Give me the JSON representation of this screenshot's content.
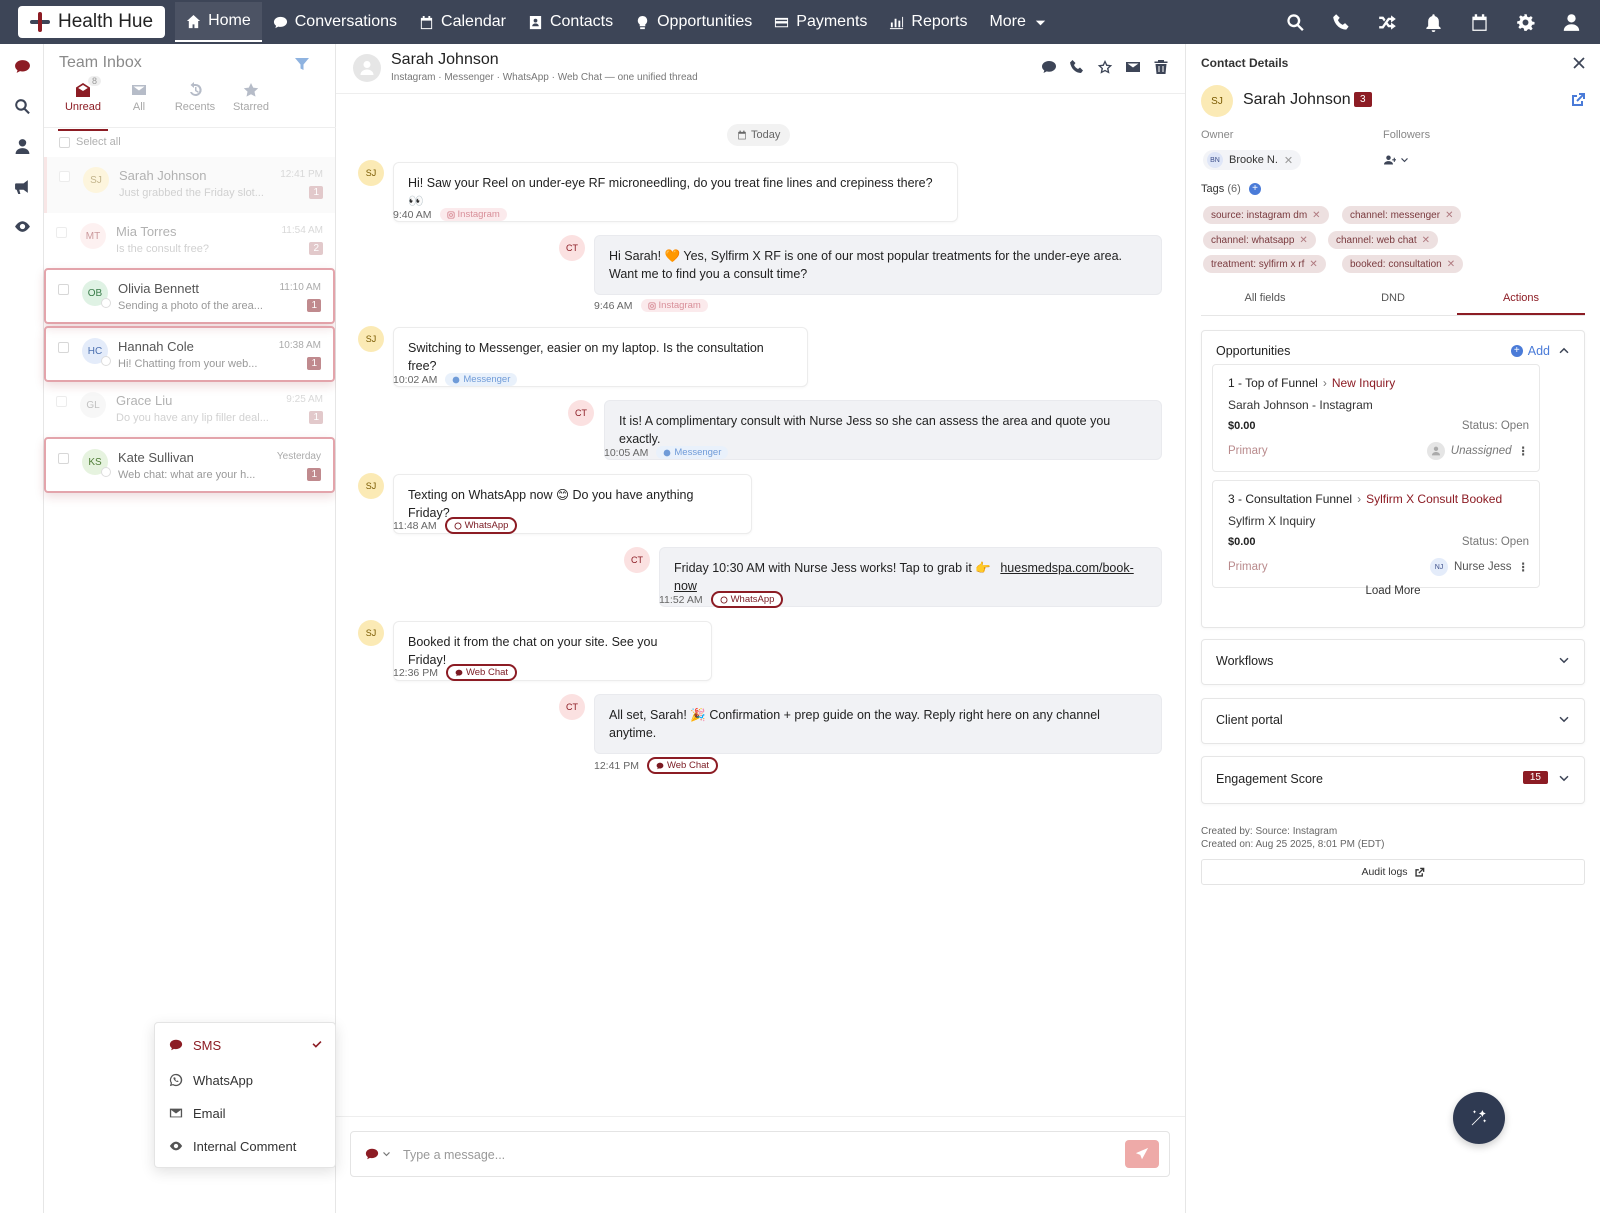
{
  "brand": {
    "name": "Health Hue"
  },
  "nav": {
    "items": [
      {
        "label": "Home",
        "icon": "home-icon"
      },
      {
        "label": "Conversations",
        "icon": "chat-icon"
      },
      {
        "label": "Calendar",
        "icon": "calendar-icon"
      },
      {
        "label": "Contacts",
        "icon": "contacts-icon"
      },
      {
        "label": "Opportunities",
        "icon": "lightbulb-icon"
      },
      {
        "label": "Payments",
        "icon": "card-icon"
      },
      {
        "label": "Reports",
        "icon": "chart-icon"
      },
      {
        "label": "More",
        "icon": "caret-down-icon"
      }
    ],
    "right_icons": [
      "search-icon",
      "phone-icon",
      "shuffle-icon",
      "bell-icon",
      "calendar-icon",
      "gear-icon",
      "user-icon"
    ]
  },
  "rail": {
    "icons": [
      "chat-icon",
      "search-icon",
      "user-icon",
      "megaphone-icon",
      "eye-icon"
    ]
  },
  "inbox": {
    "title": "Team Inbox",
    "tabs": [
      {
        "label": "Unread",
        "count": "8"
      },
      {
        "label": "All"
      },
      {
        "label": "Recents"
      },
      {
        "label": "Starred"
      }
    ],
    "select_all": "Select all",
    "conversations": [
      {
        "initials": "SJ",
        "name": "Sarah Johnson",
        "snippet": "Just grabbed the Friday slot...",
        "time": "12:41 PM",
        "badge": "1"
      },
      {
        "initials": "MT",
        "name": "Mia Torres",
        "snippet": "Is the consult free?",
        "time": "11:54 AM",
        "badge": "2"
      },
      {
        "initials": "OB",
        "name": "Olivia Bennett",
        "snippet": "Sending a photo of the area...",
        "time": "11:10 AM",
        "badge": "1"
      },
      {
        "initials": "HC",
        "name": "Hannah Cole",
        "snippet": "Hi! Chatting from your web...",
        "time": "10:38 AM",
        "badge": "1"
      },
      {
        "initials": "GL",
        "name": "Grace Liu",
        "snippet": "Do you have any lip filler deal...",
        "time": "9:25 AM",
        "badge": "1"
      },
      {
        "initials": "KS",
        "name": "Kate Sullivan",
        "snippet": "Web chat: what are your h...",
        "time": "Yesterday",
        "badge": "1"
      }
    ]
  },
  "channel_menu": {
    "items": [
      {
        "label": "SMS"
      },
      {
        "label": "WhatsApp"
      },
      {
        "label": "Email"
      },
      {
        "label": "Internal Comment"
      }
    ]
  },
  "chat": {
    "name": "Sarah Johnson",
    "subtitle": "Instagram · Messenger · WhatsApp · Web Chat — one unified thread",
    "today": "Today",
    "messages": [
      {
        "from": "SJ",
        "text": "Hi! Saw your Reel on under-eye RF microneedling, do you treat fine lines and crepiness there? 👀",
        "time": "9:40 AM",
        "channel": "Instagram"
      },
      {
        "from": "CT",
        "text": "Hi Sarah! 🧡 Yes, Sylfirm X RF is one of our most popular treatments for the under-eye area. Want me to find you a consult time?",
        "time": "9:46 AM",
        "channel": "Instagram"
      },
      {
        "from": "SJ",
        "text": "Switching to Messenger, easier on my laptop. Is the consultation free?",
        "time": "10:02 AM",
        "channel": "Messenger"
      },
      {
        "from": "CT",
        "text": "It is! A complimentary consult with Nurse Jess so she can assess the area and quote you exactly.",
        "time": "10:05 AM",
        "channel": "Messenger"
      },
      {
        "from": "SJ",
        "text": "Texting on WhatsApp now 😊 Do you have anything Friday?",
        "time": "11:48 AM",
        "channel": "WhatsApp"
      },
      {
        "from": "CT",
        "text": "Friday 10:30 AM with Nurse Jess works! Tap to grab it 👉",
        "link": "huesmedspa.com/book-now",
        "time": "11:52 AM",
        "channel": "WhatsApp"
      },
      {
        "from": "SJ",
        "text": "Booked it from the chat on your site. See you Friday!",
        "time": "12:36 PM",
        "channel": "Web Chat"
      },
      {
        "from": "CT",
        "text": "All set, Sarah! 🎉 Confirmation + prep guide on the way. Reply right here on any channel anytime.",
        "time": "12:41 PM",
        "channel": "Web Chat"
      }
    ],
    "composer_placeholder": "Type a message..."
  },
  "details": {
    "title": "Contact Details",
    "initials": "SJ",
    "name": "Sarah Johnson",
    "badge": "3",
    "owner_label": "Owner",
    "owner_initials": "BN",
    "owner_name": "Brooke N.",
    "followers_label": "Followers",
    "tags_label": "Tags",
    "tags_count": "(6)",
    "tags": [
      "source: instagram dm",
      "channel: messenger",
      "channel: whatsapp",
      "channel: web chat",
      "treatment: sylfirm x rf",
      "booked: consultation"
    ],
    "tabs": [
      "All fields",
      "DND",
      "Actions"
    ],
    "opportunities": {
      "title": "Opportunities",
      "add": "Add",
      "items": [
        {
          "pipeline": "1 - Top of Funnel",
          "stage": "New Inquiry",
          "name": "Sarah Johnson - Instagram",
          "value": "$0.00",
          "status": "Status: Open",
          "primary": "Primary",
          "assignee": "Unassigned",
          "assignee_initials": ""
        },
        {
          "pipeline": "3 - Consultation Funnel",
          "stage": "Sylfirm X Consult Booked",
          "name": "Sylfirm X Inquiry",
          "value": "$0.00",
          "status": "Status: Open",
          "primary": "Primary",
          "assignee": "Nurse Jess",
          "assignee_initials": "NJ"
        }
      ],
      "load_more": "Load More"
    },
    "sections": [
      {
        "title": "Workflows"
      },
      {
        "title": "Client portal"
      },
      {
        "title": "Engagement Score",
        "score": "15"
      }
    ],
    "created_by": "Created by: Source: Instagram",
    "created_on": "Created on: Aug 25 2025, 8:01 PM (EDT)",
    "audit_logs": "Audit logs"
  },
  "colors": {
    "topbar": "#3d4557",
    "accent": "#8c1c24",
    "link_blue": "#4a7bd8"
  }
}
